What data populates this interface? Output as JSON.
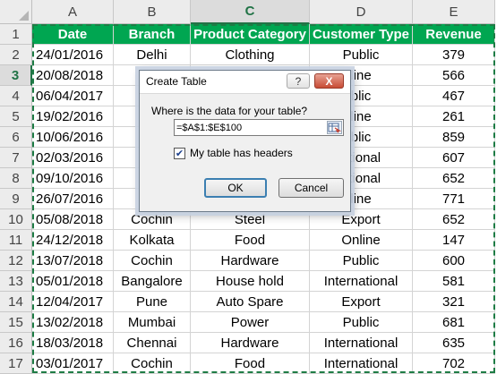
{
  "columns": [
    "A",
    "B",
    "C",
    "D",
    "E"
  ],
  "active_column": "C",
  "active_row": "3",
  "header_row": {
    "row_number": "1",
    "cells": [
      "Date",
      "Branch",
      "Product Category",
      "Customer Type",
      "Revenue"
    ]
  },
  "rows": [
    {
      "num": "2",
      "cells": [
        "24/01/2016",
        "Delhi",
        "Clothing",
        "Public",
        "379"
      ]
    },
    {
      "num": "3",
      "cells": [
        "20/08/2018",
        "Lu",
        "",
        "line",
        "566"
      ]
    },
    {
      "num": "4",
      "cells": [
        "06/04/2017",
        "J",
        "",
        "blic",
        "467"
      ]
    },
    {
      "num": "5",
      "cells": [
        "19/02/2016",
        "K",
        "",
        "line",
        "261"
      ]
    },
    {
      "num": "6",
      "cells": [
        "10/06/2016",
        "K",
        "",
        "blic",
        "859"
      ]
    },
    {
      "num": "7",
      "cells": [
        "02/03/2016",
        "M",
        "",
        "ational",
        "607"
      ]
    },
    {
      "num": "8",
      "cells": [
        "09/10/2016",
        "",
        "",
        "ational",
        "652"
      ]
    },
    {
      "num": "9",
      "cells": [
        "26/07/2016",
        "",
        "",
        "line",
        "771"
      ]
    },
    {
      "num": "10",
      "cells": [
        "05/08/2018",
        "Cochin",
        "Steel",
        "Export",
        "652"
      ]
    },
    {
      "num": "11",
      "cells": [
        "24/12/2018",
        "Kolkata",
        "Food",
        "Online",
        "147"
      ]
    },
    {
      "num": "12",
      "cells": [
        "13/07/2018",
        "Cochin",
        "Hardware",
        "Public",
        "600"
      ]
    },
    {
      "num": "13",
      "cells": [
        "05/01/2018",
        "Bangalore",
        "House hold",
        "International",
        "581"
      ]
    },
    {
      "num": "14",
      "cells": [
        "12/04/2017",
        "Pune",
        "Auto Spare",
        "Export",
        "321"
      ]
    },
    {
      "num": "15",
      "cells": [
        "13/02/2018",
        "Mumbai",
        "Power",
        "Public",
        "681"
      ]
    },
    {
      "num": "16",
      "cells": [
        "18/03/2018",
        "Chennai",
        "Hardware",
        "International",
        "635"
      ]
    },
    {
      "num": "17",
      "cells": [
        "03/01/2017",
        "Cochin",
        "Food",
        "International",
        "702"
      ]
    }
  ],
  "dialog": {
    "title": "Create Table",
    "help_label": "?",
    "close_label": "X",
    "prompt": "Where is the data for your table?",
    "range_value": "=$A$1:$E$100",
    "checkbox_checked": true,
    "checkbox_label": "My table has headers",
    "ok_label": "OK",
    "cancel_label": "Cancel",
    "collapse_icon": "range-selector-icon"
  },
  "colors": {
    "header_fill": "#00a651",
    "header_text": "#ffffff",
    "marquee": "#1e7c45",
    "active_header": "#217346"
  }
}
